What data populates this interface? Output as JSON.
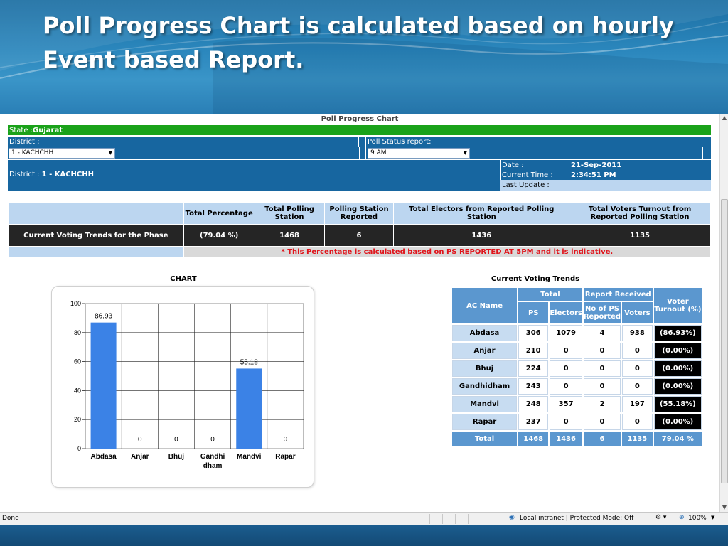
{
  "slide": {
    "title": "Poll Progress Chart is calculated based on hourly Event based Report."
  },
  "page": {
    "title": "Poll Progress Chart",
    "state_label": "State : ",
    "state_value": "Gujarat",
    "district_label": "District :",
    "poll_status_label": "Poll Status report:",
    "district_select": "1 - KACHCHH",
    "poll_select": "9 AM",
    "district_info_label": "District : ",
    "district_info_value": "1 - KACHCHH",
    "date_label": "Date :",
    "date_value": "21-Sep-2011",
    "time_label": "Current Time :",
    "time_value": "2:34:51 PM",
    "last_update_label": "Last Update :"
  },
  "summary": {
    "headers": [
      "Total Percentage",
      "Total Polling Station",
      "Polling Station Reported",
      "Total Electors from Reported Polling Station",
      "Total Voters Turnout from Reported Polling Station"
    ],
    "row_label": "Current Voting Trends for the Phase",
    "values": [
      "(79.04 %)",
      "1468",
      "6",
      "1436",
      "1135"
    ],
    "note": "* This Percentage is calculated based on PS REPORTED AT 5PM and it is indicative."
  },
  "chart_data": {
    "type": "bar",
    "title": "CHART",
    "categories": [
      "Abdasa",
      "Anjar",
      "Bhuj",
      "Gandhi dham",
      "Mandvi",
      "Rapar"
    ],
    "values": [
      86.93,
      0,
      0,
      0,
      55.18,
      0
    ],
    "value_labels": [
      "86.93",
      "0",
      "0",
      "0",
      "55.18",
      "0"
    ],
    "ylim": [
      0,
      100
    ],
    "yticks": [
      "0",
      "20",
      "40",
      "60",
      "80",
      "100"
    ],
    "grid": true,
    "color": "#3b82e6"
  },
  "trends": {
    "title": "Current Voting Trends",
    "headers": {
      "ac": "AC Name",
      "total": "Total",
      "report": "Report Received",
      "turnout": "Voter Turnout (%)",
      "ps": "PS",
      "electors": "Electors",
      "nops": "No of PS Reported",
      "voters": "Voters"
    },
    "rows": [
      {
        "name": "Abdasa",
        "ps": "306",
        "electors": "1079",
        "nops": "4",
        "voters": "938",
        "turnout": "(86.93%)"
      },
      {
        "name": "Anjar",
        "ps": "210",
        "electors": "0",
        "nops": "0",
        "voters": "0",
        "turnout": "(0.00%)"
      },
      {
        "name": "Bhuj",
        "ps": "224",
        "electors": "0",
        "nops": "0",
        "voters": "0",
        "turnout": "(0.00%)"
      },
      {
        "name": "Gandhidham",
        "ps": "243",
        "electors": "0",
        "nops": "0",
        "voters": "0",
        "turnout": "(0.00%)"
      },
      {
        "name": "Mandvi",
        "ps": "248",
        "electors": "357",
        "nops": "2",
        "voters": "197",
        "turnout": "(55.18%)"
      },
      {
        "name": "Rapar",
        "ps": "237",
        "electors": "0",
        "nops": "0",
        "voters": "0",
        "turnout": "(0.00%)"
      }
    ],
    "total": {
      "name": "Total",
      "ps": "1468",
      "electors": "1436",
      "nops": "6",
      "voters": "1135",
      "turnout": "79.04 %"
    }
  },
  "statusbar": {
    "status": "Done",
    "zone": "Local intranet | Protected Mode: Off",
    "zoom": "100%"
  }
}
